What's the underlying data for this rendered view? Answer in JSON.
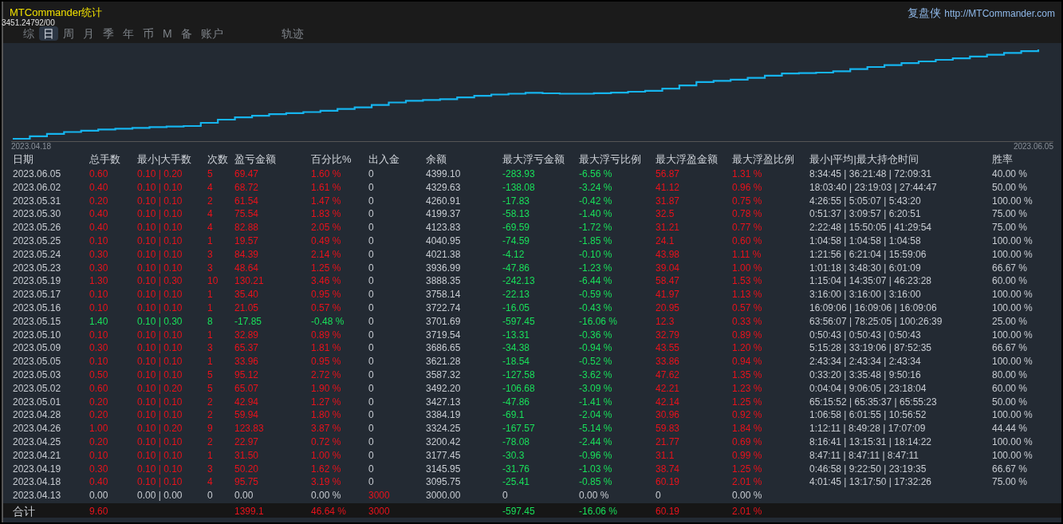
{
  "window": {
    "title": "MTCommander统计",
    "brand": "复盘侠",
    "url": "http://MTCommander.com",
    "overlay_value": "3451.24792/00"
  },
  "tabs": [
    {
      "label": "综",
      "selected": false
    },
    {
      "label": "日",
      "selected": true
    },
    {
      "label": "周",
      "selected": false
    },
    {
      "label": "月",
      "selected": false
    },
    {
      "label": "季",
      "selected": false
    },
    {
      "label": "年",
      "selected": false
    },
    {
      "label": "币",
      "selected": false
    },
    {
      "label": "M",
      "selected": false
    },
    {
      "label": "备",
      "selected": false
    },
    {
      "label": "账户",
      "selected": false
    },
    {
      "label": "轨迹",
      "selected": false
    }
  ],
  "chart": {
    "start_label": "2023.04.18",
    "end_label": "2023.06.05"
  },
  "table": {
    "columns": [
      {
        "label": "日期",
        "kind": "plain"
      },
      {
        "label": "总手数",
        "kind": "row"
      },
      {
        "label": "最小|大手数",
        "kind": "row"
      },
      {
        "label": "次数",
        "kind": "row"
      },
      {
        "label": "盈亏金额",
        "kind": "row"
      },
      {
        "label": "百分比%",
        "kind": "row"
      },
      {
        "label": "出入金",
        "kind": "cash"
      },
      {
        "label": "余额",
        "kind": "plain"
      },
      {
        "label": "最大浮亏金额",
        "kind": "loss"
      },
      {
        "label": "最大浮亏比例",
        "kind": "loss"
      },
      {
        "label": "最大浮盈金额",
        "kind": "gain"
      },
      {
        "label": "最大浮盈比例",
        "kind": "gain"
      },
      {
        "label": "最小|平均|最大持仓时间",
        "kind": "plain"
      },
      {
        "label": "胜率",
        "kind": "plain"
      }
    ],
    "rows": [
      {
        "kind": "profit",
        "cash_flag": false,
        "cells": [
          "2023.06.05",
          "0.60",
          "0.10 | 0.20",
          "5",
          "69.47",
          "1.60 %",
          "0",
          "4399.10",
          "-283.93",
          "-6.56 %",
          "56.87",
          "1.31 %",
          "8:34:45 | 36:21:48 | 72:09:31",
          "40.00 %"
        ]
      },
      {
        "kind": "profit",
        "cash_flag": false,
        "cells": [
          "2023.06.02",
          "0.40",
          "0.10 | 0.10",
          "4",
          "68.72",
          "1.61 %",
          "0",
          "4329.63",
          "-138.08",
          "-3.24 %",
          "41.12",
          "0.96 %",
          "18:03:40 | 23:19:03 | 27:44:47",
          "50.00 %"
        ]
      },
      {
        "kind": "profit",
        "cash_flag": false,
        "cells": [
          "2023.05.31",
          "0.20",
          "0.10 | 0.10",
          "2",
          "61.54",
          "1.47 %",
          "0",
          "4260.91",
          "-17.83",
          "-0.42 %",
          "31.87",
          "0.75 %",
          "4:26:55 | 5:05:07 | 5:43:20",
          "100.00 %"
        ]
      },
      {
        "kind": "profit",
        "cash_flag": false,
        "cells": [
          "2023.05.30",
          "0.40",
          "0.10 | 0.10",
          "4",
          "75.54",
          "1.83 %",
          "0",
          "4199.37",
          "-58.13",
          "-1.40 %",
          "32.5",
          "0.78 %",
          "0:51:37 | 3:09:57 | 6:20:51",
          "75.00 %"
        ]
      },
      {
        "kind": "profit",
        "cash_flag": false,
        "cells": [
          "2023.05.26",
          "0.40",
          "0.10 | 0.10",
          "4",
          "82.88",
          "2.05 %",
          "0",
          "4123.83",
          "-69.59",
          "-1.72 %",
          "31.21",
          "0.77 %",
          "2:22:48 | 15:50:05 | 41:29:54",
          "75.00 %"
        ]
      },
      {
        "kind": "profit",
        "cash_flag": false,
        "cells": [
          "2023.05.25",
          "0.10",
          "0.10 | 0.10",
          "1",
          "19.57",
          "0.49 %",
          "0",
          "4040.95",
          "-74.59",
          "-1.85 %",
          "24.1",
          "0.60 %",
          "1:04:58 | 1:04:58 | 1:04:58",
          "100.00 %"
        ]
      },
      {
        "kind": "profit",
        "cash_flag": false,
        "cells": [
          "2023.05.24",
          "0.30",
          "0.10 | 0.10",
          "3",
          "84.39",
          "2.14 %",
          "0",
          "4021.38",
          "-4.12",
          "-0.10 %",
          "43.98",
          "1.11 %",
          "1:21:56 | 6:21:04 | 15:59:06",
          "100.00 %"
        ]
      },
      {
        "kind": "profit",
        "cash_flag": false,
        "cells": [
          "2023.05.23",
          "0.30",
          "0.10 | 0.10",
          "3",
          "48.64",
          "1.25 %",
          "0",
          "3936.99",
          "-47.86",
          "-1.23 %",
          "39.04",
          "1.00 %",
          "1:01:18 | 3:48:30 | 6:01:09",
          "66.67 %"
        ]
      },
      {
        "kind": "profit",
        "cash_flag": false,
        "cells": [
          "2023.05.19",
          "1.30",
          "0.10 | 0.30",
          "10",
          "130.21",
          "3.46 %",
          "0",
          "3888.35",
          "-242.13",
          "-6.44 %",
          "58.47",
          "1.53 %",
          "1:15:04 | 14:35:07 | 46:23:28",
          "60.00 %"
        ]
      },
      {
        "kind": "profit",
        "cash_flag": false,
        "cells": [
          "2023.05.17",
          "0.10",
          "0.10 | 0.10",
          "1",
          "35.40",
          "0.95 %",
          "0",
          "3758.14",
          "-22.13",
          "-0.59 %",
          "41.97",
          "1.13 %",
          "3:16:00 | 3:16:00 | 3:16:00",
          "100.00 %"
        ]
      },
      {
        "kind": "profit",
        "cash_flag": false,
        "cells": [
          "2023.05.16",
          "0.10",
          "0.10 | 0.10",
          "1",
          "21.05",
          "0.57 %",
          "0",
          "3722.74",
          "-16.05",
          "-0.43 %",
          "20.95",
          "0.57 %",
          "16:09:06 | 16:09:06 | 16:09:06",
          "100.00 %"
        ]
      },
      {
        "kind": "loss",
        "cash_flag": false,
        "cells": [
          "2023.05.15",
          "1.40",
          "0.10 | 0.30",
          "8",
          "-17.85",
          "-0.48 %",
          "0",
          "3701.69",
          "-597.45",
          "-16.06 %",
          "12.3",
          "0.33 %",
          "63:56:07 | 78:25:05 | 100:26:39",
          "25.00 %"
        ]
      },
      {
        "kind": "profit",
        "cash_flag": false,
        "cells": [
          "2023.05.10",
          "0.10",
          "0.10 | 0.10",
          "1",
          "32.89",
          "0.89 %",
          "0",
          "3719.54",
          "-13.31",
          "-0.36 %",
          "32.79",
          "0.89 %",
          "0:50:43 | 0:50:43 | 0:50:43",
          "100.00 %"
        ]
      },
      {
        "kind": "profit",
        "cash_flag": false,
        "cells": [
          "2023.05.09",
          "0.30",
          "0.10 | 0.10",
          "3",
          "65.37",
          "1.81 %",
          "0",
          "3686.65",
          "-34.38",
          "-0.94 %",
          "43.55",
          "1.20 %",
          "5:15:28 | 33:19:06 | 87:52:35",
          "66.67 %"
        ]
      },
      {
        "kind": "profit",
        "cash_flag": false,
        "cells": [
          "2023.05.05",
          "0.10",
          "0.10 | 0.10",
          "1",
          "33.96",
          "0.95 %",
          "0",
          "3621.28",
          "-18.54",
          "-0.52 %",
          "33.86",
          "0.94 %",
          "2:43:34 | 2:43:34 | 2:43:34",
          "100.00 %"
        ]
      },
      {
        "kind": "profit",
        "cash_flag": false,
        "cells": [
          "2023.05.03",
          "0.50",
          "0.10 | 0.10",
          "5",
          "95.12",
          "2.72 %",
          "0",
          "3587.32",
          "-127.58",
          "-3.62 %",
          "47.62",
          "1.35 %",
          "0:33:20 | 3:35:48 | 9:50:16",
          "80.00 %"
        ]
      },
      {
        "kind": "profit",
        "cash_flag": false,
        "cells": [
          "2023.05.02",
          "0.60",
          "0.10 | 0.20",
          "5",
          "65.07",
          "1.90 %",
          "0",
          "3492.20",
          "-106.68",
          "-3.09 %",
          "42.21",
          "1.23 %",
          "0:04:04 | 9:06:05 | 23:18:04",
          "60.00 %"
        ]
      },
      {
        "kind": "profit",
        "cash_flag": false,
        "cells": [
          "2023.05.01",
          "0.20",
          "0.10 | 0.10",
          "2",
          "42.94",
          "1.27 %",
          "0",
          "3427.13",
          "-47.86",
          "-1.41 %",
          "42.14",
          "1.25 %",
          "65:15:52 | 65:35:37 | 65:55:23",
          "50.00 %"
        ]
      },
      {
        "kind": "profit",
        "cash_flag": false,
        "cells": [
          "2023.04.28",
          "0.20",
          "0.10 | 0.10",
          "2",
          "59.94",
          "1.80 %",
          "0",
          "3384.19",
          "-69.1",
          "-2.04 %",
          "30.96",
          "0.92 %",
          "1:06:58 | 6:01:55 | 10:56:52",
          "100.00 %"
        ]
      },
      {
        "kind": "profit",
        "cash_flag": false,
        "cells": [
          "2023.04.26",
          "1.00",
          "0.10 | 0.20",
          "9",
          "123.83",
          "3.87 %",
          "0",
          "3324.25",
          "-167.57",
          "-5.14 %",
          "59.83",
          "1.84 %",
          "1:12:11 | 8:49:28 | 17:07:09",
          "44.44 %"
        ]
      },
      {
        "kind": "profit",
        "cash_flag": false,
        "cells": [
          "2023.04.25",
          "0.20",
          "0.10 | 0.10",
          "2",
          "22.97",
          "0.72 %",
          "0",
          "3200.42",
          "-78.08",
          "-2.44 %",
          "21.77",
          "0.69 %",
          "8:16:41 | 13:15:31 | 18:14:22",
          "100.00 %"
        ]
      },
      {
        "kind": "profit",
        "cash_flag": false,
        "cells": [
          "2023.04.21",
          "0.10",
          "0.10 | 0.10",
          "1",
          "31.50",
          "1.00 %",
          "0",
          "3177.45",
          "-30.3",
          "-0.96 %",
          "31.1",
          "0.99 %",
          "8:47:11 | 8:47:11 | 8:47:11",
          "100.00 %"
        ]
      },
      {
        "kind": "profit",
        "cash_flag": false,
        "cells": [
          "2023.04.19",
          "0.30",
          "0.10 | 0.10",
          "3",
          "50.20",
          "1.62 %",
          "0",
          "3145.95",
          "-31.76",
          "-1.03 %",
          "38.74",
          "1.25 %",
          "0:46:58 | 9:22:50 | 23:19:35",
          "66.67 %"
        ]
      },
      {
        "kind": "profit",
        "cash_flag": false,
        "cells": [
          "2023.04.18",
          "0.40",
          "0.10 | 0.10",
          "4",
          "95.75",
          "3.19 %",
          "0",
          "3095.75",
          "-25.41",
          "-0.85 %",
          "60.19",
          "2.01 %",
          "4:01:45 | 13:17:50 | 17:32:26",
          "75.00 %"
        ]
      },
      {
        "kind": "neutral",
        "cash_flag": true,
        "cells": [
          "2023.04.13",
          "0.00",
          "0.00 | 0.00",
          "0",
          "0.00",
          "0.00 %",
          "3000",
          "3000.00",
          "0",
          "0.00 %",
          "0",
          "0.00 %"
        ]
      }
    ],
    "totals": {
      "kind": "profit",
      "label": "合计",
      "lots": "9.60",
      "pnl": "1399.1",
      "percent": "46.64 %",
      "cash": "3000",
      "max_float_loss": "-597.45",
      "max_float_loss_pct": "-16.06 %",
      "max_float_profit": "60.19",
      "max_float_profit_pct": "2.01 %"
    }
  }
}
